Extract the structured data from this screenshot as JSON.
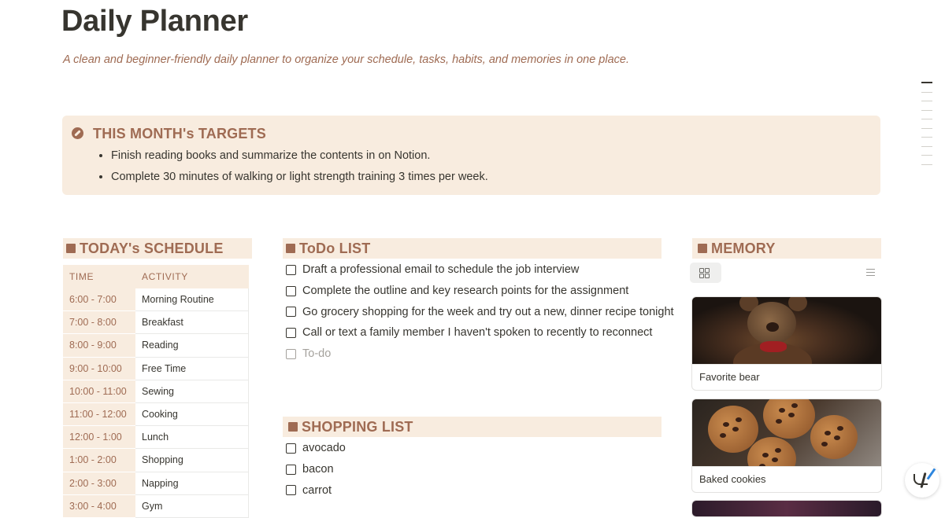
{
  "page": {
    "title": "Daily Planner",
    "subtitle": "A clean and beginner-friendly daily planner to organize your schedule, tasks, habits, and memories in one place."
  },
  "targets": {
    "title": "THIS MONTH's TARGETS",
    "items": [
      "Finish reading books and summarize the contents in on Notion.",
      "Complete 30 minutes of walking or light strength training 3 times per week."
    ]
  },
  "schedule": {
    "title": "TODAY's SCHEDULE",
    "columns": [
      "TIME",
      "ACTIVITY"
    ],
    "rows": [
      {
        "time": "6:00 - 7:00",
        "activity": "Morning Routine"
      },
      {
        "time": "7:00 - 8:00",
        "activity": "Breakfast"
      },
      {
        "time": "8:00 - 9:00",
        "activity": "Reading"
      },
      {
        "time": "9:00 - 10:00",
        "activity": "Free Time"
      },
      {
        "time": "10:00 - 11:00",
        "activity": "Sewing"
      },
      {
        "time": "11:00 - 12:00",
        "activity": "Cooking"
      },
      {
        "time": "12:00 - 1:00",
        "activity": "Lunch"
      },
      {
        "time": "1:00 - 2:00",
        "activity": "Shopping"
      },
      {
        "time": "2:00 - 3:00",
        "activity": "Napping"
      },
      {
        "time": "3:00 - 4:00",
        "activity": "Gym"
      }
    ]
  },
  "todo": {
    "title": "ToDo LIST",
    "items": [
      "Draft a professional email to schedule the job interview",
      "Complete the outline and key research points for the assignment",
      "Go grocery shopping for the week and try out a new, dinner recipe tonight",
      "Call or text a family member I haven't spoken to recently to reconnect"
    ],
    "placeholder": "To-do"
  },
  "shopping": {
    "title": "SHOPPING LIST",
    "items": [
      "avocado",
      "bacon",
      "carrot"
    ]
  },
  "memory": {
    "title": "MEMORY",
    "cards": [
      {
        "caption": "Favorite bear"
      },
      {
        "caption": "Baked cookies"
      }
    ]
  },
  "colors": {
    "accent": "#9f6b53",
    "accent_bg": "#f8ecdf",
    "text": "#37352f"
  }
}
